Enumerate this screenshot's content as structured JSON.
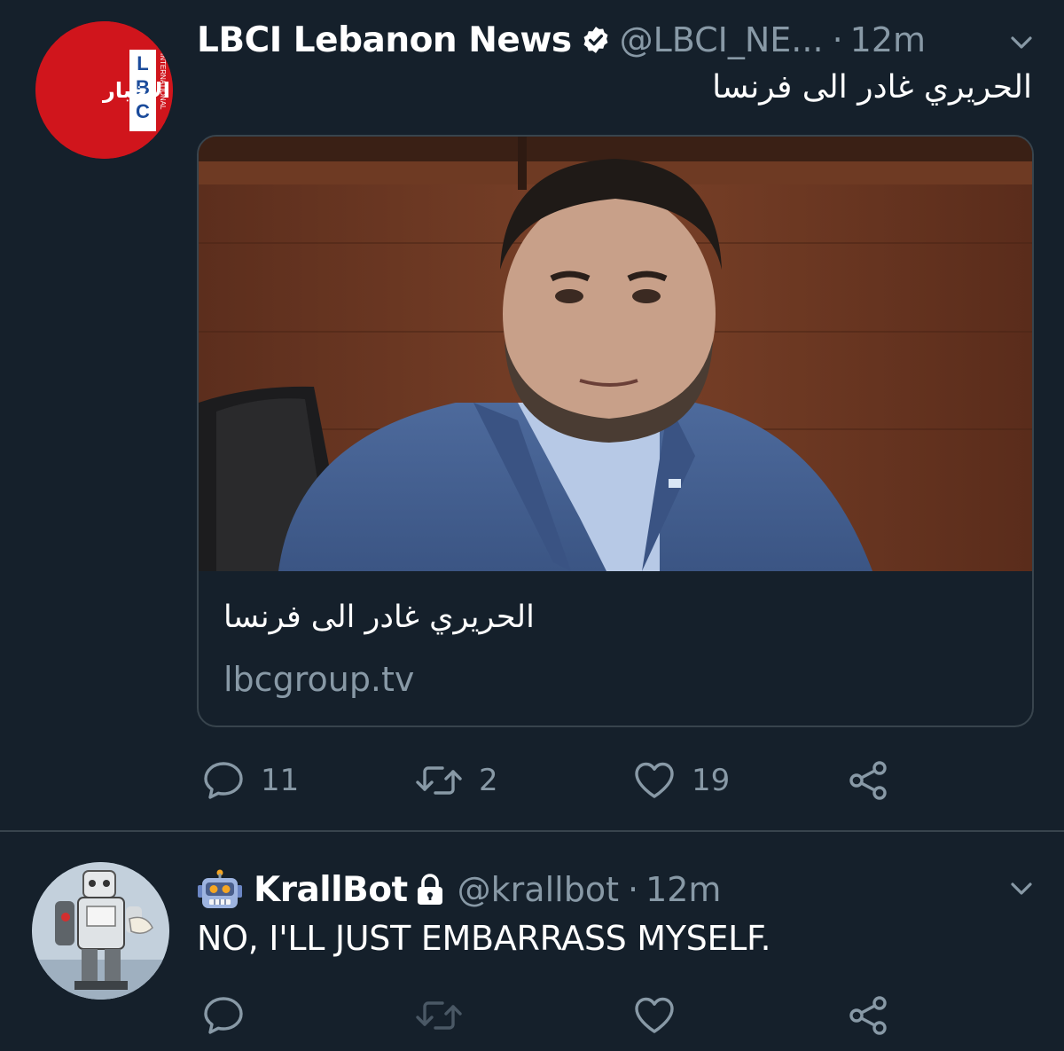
{
  "tweets": [
    {
      "avatar": {
        "brand": "LBC",
        "brand_sub": "INTERNATIONAL",
        "arabic_label": "الأخبار",
        "icon": "lbci-logo-avatar"
      },
      "name": "LBCI Lebanon News",
      "verified": true,
      "handle": "@LBCI_NE...",
      "dot": "·",
      "time": "12m",
      "text": "الحريري غادر الى فرنسا",
      "card": {
        "title": "الحريري غادر الى فرنسا",
        "domain": "lbcgroup.tv"
      },
      "actions": {
        "replies": "11",
        "retweets": "2",
        "likes": "19"
      }
    },
    {
      "avatar": {
        "icon": "robot-photo-avatar"
      },
      "name_emoji": "robot-face-icon",
      "name": "KrallBot",
      "protected": true,
      "handle": "@krallbot",
      "dot": "·",
      "time": "12m",
      "text": "NO, I'LL JUST EMBARRASS MYSELF."
    }
  ],
  "colors": {
    "background": "#15202b",
    "border": "#38444d",
    "secondary_text": "#8899a6",
    "lbc_red": "#d0151c"
  }
}
